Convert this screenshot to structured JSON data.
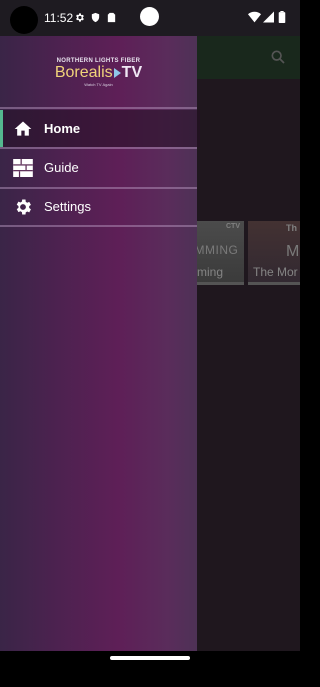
{
  "status_bar": {
    "time": "11:52",
    "icons_left": [
      "gear-icon",
      "shield-icon",
      "sim-card-icon"
    ],
    "icons_right": [
      "wifi-icon",
      "signal-icon",
      "battery-icon"
    ]
  },
  "brand": {
    "top_line": "NORTHERN LIGHTS FIBER",
    "name": "Borealis",
    "suffix": "TV",
    "tagline": "Watch TV Again"
  },
  "drawer": {
    "items": [
      {
        "label": "Home",
        "icon": "home-icon",
        "active": true
      },
      {
        "label": "Guide",
        "icon": "guide-grid-icon",
        "active": false
      },
      {
        "label": "Settings",
        "icon": "gear-icon",
        "active": false
      }
    ]
  },
  "background": {
    "toolbar_icon": "search-icon",
    "tiles": [
      {
        "logo": "CTV",
        "big_text": "AMMING",
        "caption": "mming"
      },
      {
        "logo": "Th",
        "big_text": "M",
        "caption": "The Mor"
      }
    ]
  },
  "colors": {
    "accent": "#54b88f",
    "brand_gold": "#f0d37a",
    "drawer_base": "#5e1f57"
  }
}
